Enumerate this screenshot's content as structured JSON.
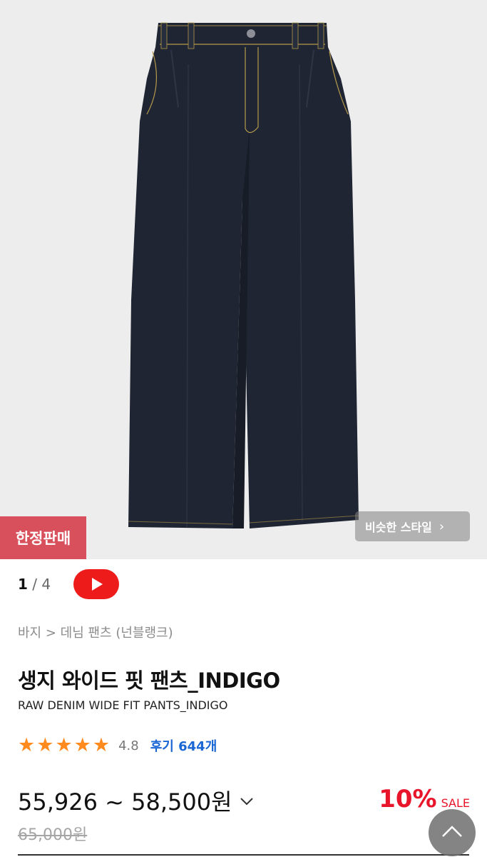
{
  "gallery": {
    "badge": "한정판매",
    "similar_style_label": "비슷한 스타일",
    "similar_style_icon": "chevron-right-icon",
    "page_current": "1",
    "page_separator": "/",
    "page_total": "4",
    "video_icon": "play-icon"
  },
  "product": {
    "breadcrumb": "바지 > 데님 팬츠 (넌블랭크)",
    "title": "생지 와이드 핏 팬츠_INDIGO",
    "subtitle": "RAW DENIM WIDE FIT PANTS_INDIGO",
    "rating_value": 4.8,
    "rating_display": "4.8",
    "review_label": "후기 644개",
    "price_range": "55,926 ~ 58,500원",
    "original_price": "65,000원",
    "discount_percent": "10%",
    "sale_label": "SALE"
  },
  "colors": {
    "badge_bg": "#d9505d",
    "star": "#ff8a1e",
    "review_link": "#1a66d4",
    "discount": "#e8142a",
    "youtube_red": "#ee1b1b",
    "denim": "#1f2532"
  },
  "icons": {
    "price_dropdown": "chevron-down-icon",
    "scroll_top": "chevron-up-icon"
  }
}
